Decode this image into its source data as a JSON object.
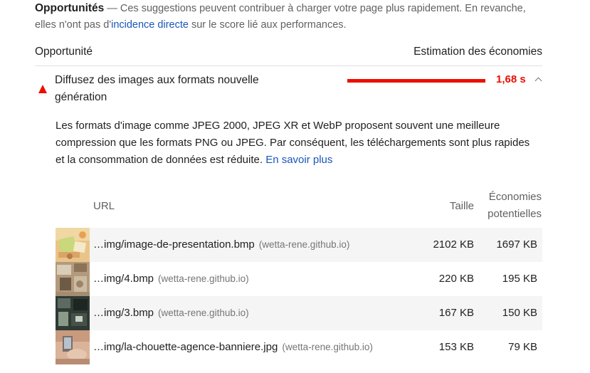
{
  "section": {
    "title": "Opportunités",
    "description_prefix": "Ces suggestions peuvent contribuer à charger votre page plus rapidement. En revanche, elles n'ont pas d'",
    "description_link": "incidence directe",
    "description_suffix": " sur le score lié aux performances."
  },
  "columns": {
    "opportunity": "Opportunité",
    "estimated_savings": "Estimation des économies"
  },
  "audit": {
    "title": "Diffusez des images aux formats nouvelle génération",
    "savings": "1,68 s",
    "status_color": "#eb0f00",
    "description": "Les formats d'image comme JPEG 2000, JPEG XR et WebP proposent souvent une meilleure compression que les formats PNG ou JPEG. Par conséquent, les téléchargements sont plus rapides et la consommation de données est réduite. ",
    "learn_more": "En savoir plus"
  },
  "table": {
    "headers": {
      "url": "URL",
      "size": "Taille",
      "savings_line1": "Économies",
      "savings_line2": "potentielles"
    },
    "rows": [
      {
        "path": "…img/image-de-presentation.bmp",
        "host": "(wetta-rene.github.io)",
        "size": "2102 KB",
        "savings": "1697 KB"
      },
      {
        "path": "…img/4.bmp",
        "host": "(wetta-rene.github.io)",
        "size": "220 KB",
        "savings": "195 KB"
      },
      {
        "path": "…img/3.bmp",
        "host": "(wetta-rene.github.io)",
        "size": "167 KB",
        "savings": "150 KB"
      },
      {
        "path": "…img/la-chouette-agence-banniere.jpg",
        "host": "(wetta-rene.github.io)",
        "size": "153 KB",
        "savings": "79 KB"
      }
    ]
  }
}
